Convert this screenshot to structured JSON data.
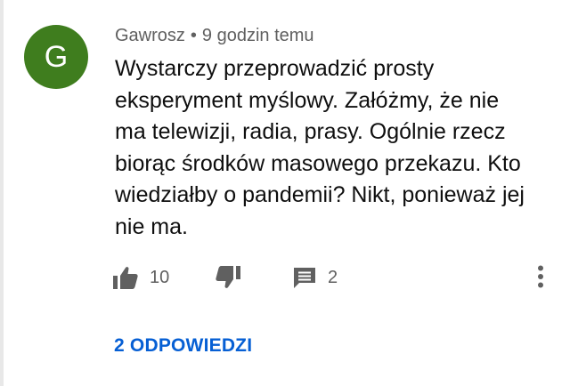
{
  "comment": {
    "avatar": {
      "letter": "G",
      "color": "#3f7d1e"
    },
    "author": "Gawrosz",
    "separator": "•",
    "time": "9 godzin temu",
    "text": "Wystarczy przeprowadzić prosty\neksperyment myślowy. Załóżmy, że nie\nma telewizji, radia, prasy. Ogólnie rzecz\nbiorąc środków masowego przekazu. Kto\nwiedziałby o pandemii? Nikt, ponieważ jej\nnie ma.",
    "actions": {
      "like": {
        "icon": "thumbs-up-icon",
        "count": "10"
      },
      "dislike": {
        "icon": "thumbs-down-icon"
      },
      "reply": {
        "icon": "comment-icon",
        "count": "2"
      },
      "menu": {
        "icon": "more-vertical-icon"
      }
    },
    "replies_link": "2 ODPOWIEDZI"
  },
  "colors": {
    "link": "#065fd4",
    "icon": "#606060",
    "text": "#0f0f0f",
    "meta": "#606060"
  }
}
